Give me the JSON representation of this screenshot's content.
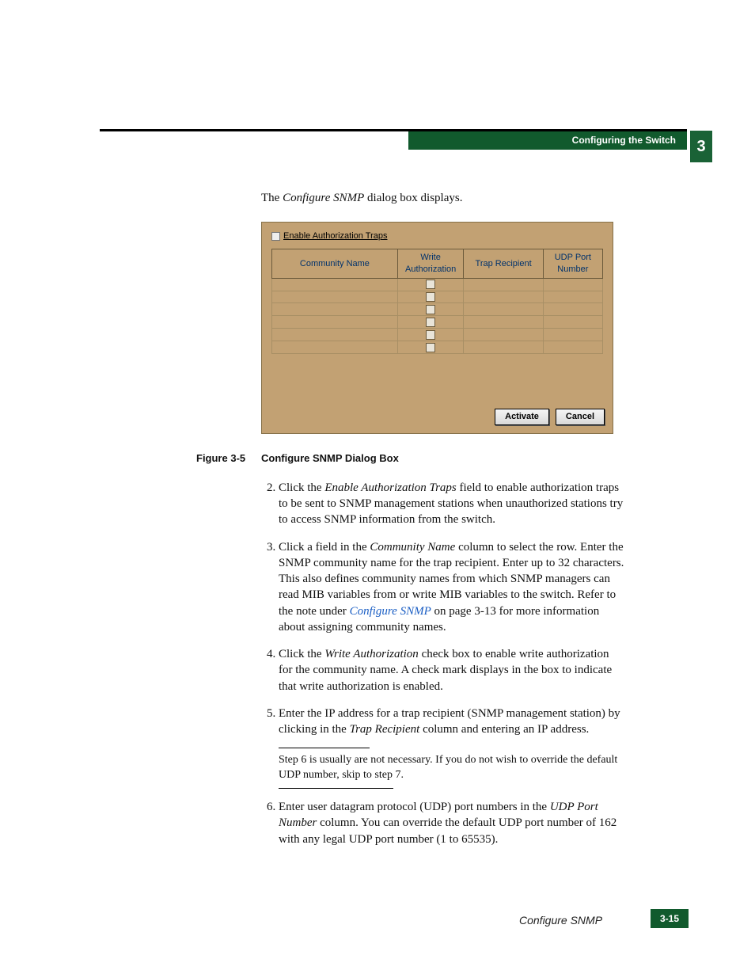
{
  "header": {
    "sectionTitle": "Configuring the Switch",
    "chapterNumber": "3"
  },
  "intro": {
    "prefix": "The ",
    "dialogName": "Configure SNMP",
    "suffix": " dialog box displays."
  },
  "snmpDialog": {
    "enableLabel": "Enable Authorization Traps",
    "columns": {
      "community": "Community Name",
      "writeAuth": "Write Authorization",
      "trap": "Trap Recipient",
      "udp": "UDP Port Number"
    },
    "activate": "Activate",
    "cancel": "Cancel"
  },
  "figureCaption": {
    "label": "Figure 3-5",
    "title": "Configure SNMP Dialog Box"
  },
  "steps": {
    "s2_a": "Click the ",
    "s2_i": "Enable Authorization Traps",
    "s2_b": " field to enable authorization traps to be sent to SNMP management stations when unauthorized stations try to access SNMP information from the switch.",
    "s3_a": "Click a field in the ",
    "s3_i": "Community Name",
    "s3_b": " column to select the row. Enter the SNMP community name for the trap recipient. Enter up to 32 characters. This also defines community names from which SNMP managers can read MIB variables from or write MIB variables to the switch. Refer to the note under ",
    "s3_link": "Configure SNMP",
    "s3_c": " on page 3-13 for more information about assigning community names.",
    "s4_a": "Click the ",
    "s4_i": "Write Authorization",
    "s4_b": " check box to enable write authorization for the community name. A check mark displays in the box to indicate that write authorization is enabled.",
    "s5_a": "Enter the IP address for a trap recipient (SNMP management station) by clicking in the ",
    "s5_i": "Trap Recipient",
    "s5_b": " column and entering an IP address.",
    "note": "Step 6 is usually are not necessary. If you do not wish to override the default UDP number, skip to step 7.",
    "s6_a": "Enter user datagram protocol (UDP) port numbers in the ",
    "s6_i": "UDP Port Number",
    "s6_b": " column. You can override the default UDP port number of 162 with any legal UDP port number (1 to 65535)."
  },
  "footer": {
    "title": "Configure SNMP",
    "page": "3-15"
  }
}
